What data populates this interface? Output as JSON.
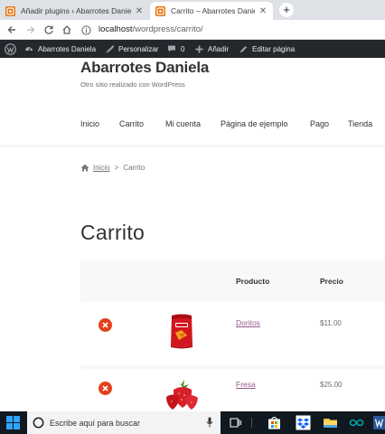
{
  "browser": {
    "tabs": [
      {
        "title": "Añadir plugins ‹ Abarrotes Daniela",
        "close": "✕"
      },
      {
        "title": "Carrito – Abarrotes Daniela",
        "close": "✕"
      }
    ],
    "new_tab": "+",
    "url_host": "localhost",
    "url_path": "/wordpress/carrito/"
  },
  "admin_bar": {
    "site": "Abarrotes Daniela",
    "customize": "Personalizar",
    "comments": "0",
    "new": "Añadir",
    "edit": "Editar página"
  },
  "site": {
    "title": "Abarrotes Daniela",
    "description": "Otro sitio realizado con WordPress"
  },
  "nav": [
    "Inicio",
    "Carrito",
    "Mi cuenta",
    "Página de ejemplo",
    "Pago",
    "Tienda"
  ],
  "breadcrumb": {
    "home": "Inicio",
    "separator": ">",
    "current": "Carrito"
  },
  "page": {
    "title": "Carrito"
  },
  "cart": {
    "headers": {
      "product": "Producto",
      "price": "Precio"
    },
    "items": [
      {
        "name": "Doritos",
        "price": "$11.00"
      },
      {
        "name": "Fresa",
        "price": "$25.00"
      }
    ]
  },
  "taskbar": {
    "search_placeholder": "Escribe aquí para buscar"
  },
  "colors": {
    "admin_bar": "#23282d",
    "link": "#96588a",
    "remove": "#e2401c",
    "table_head": "#f8f8f8",
    "taskbar": "#101820"
  }
}
